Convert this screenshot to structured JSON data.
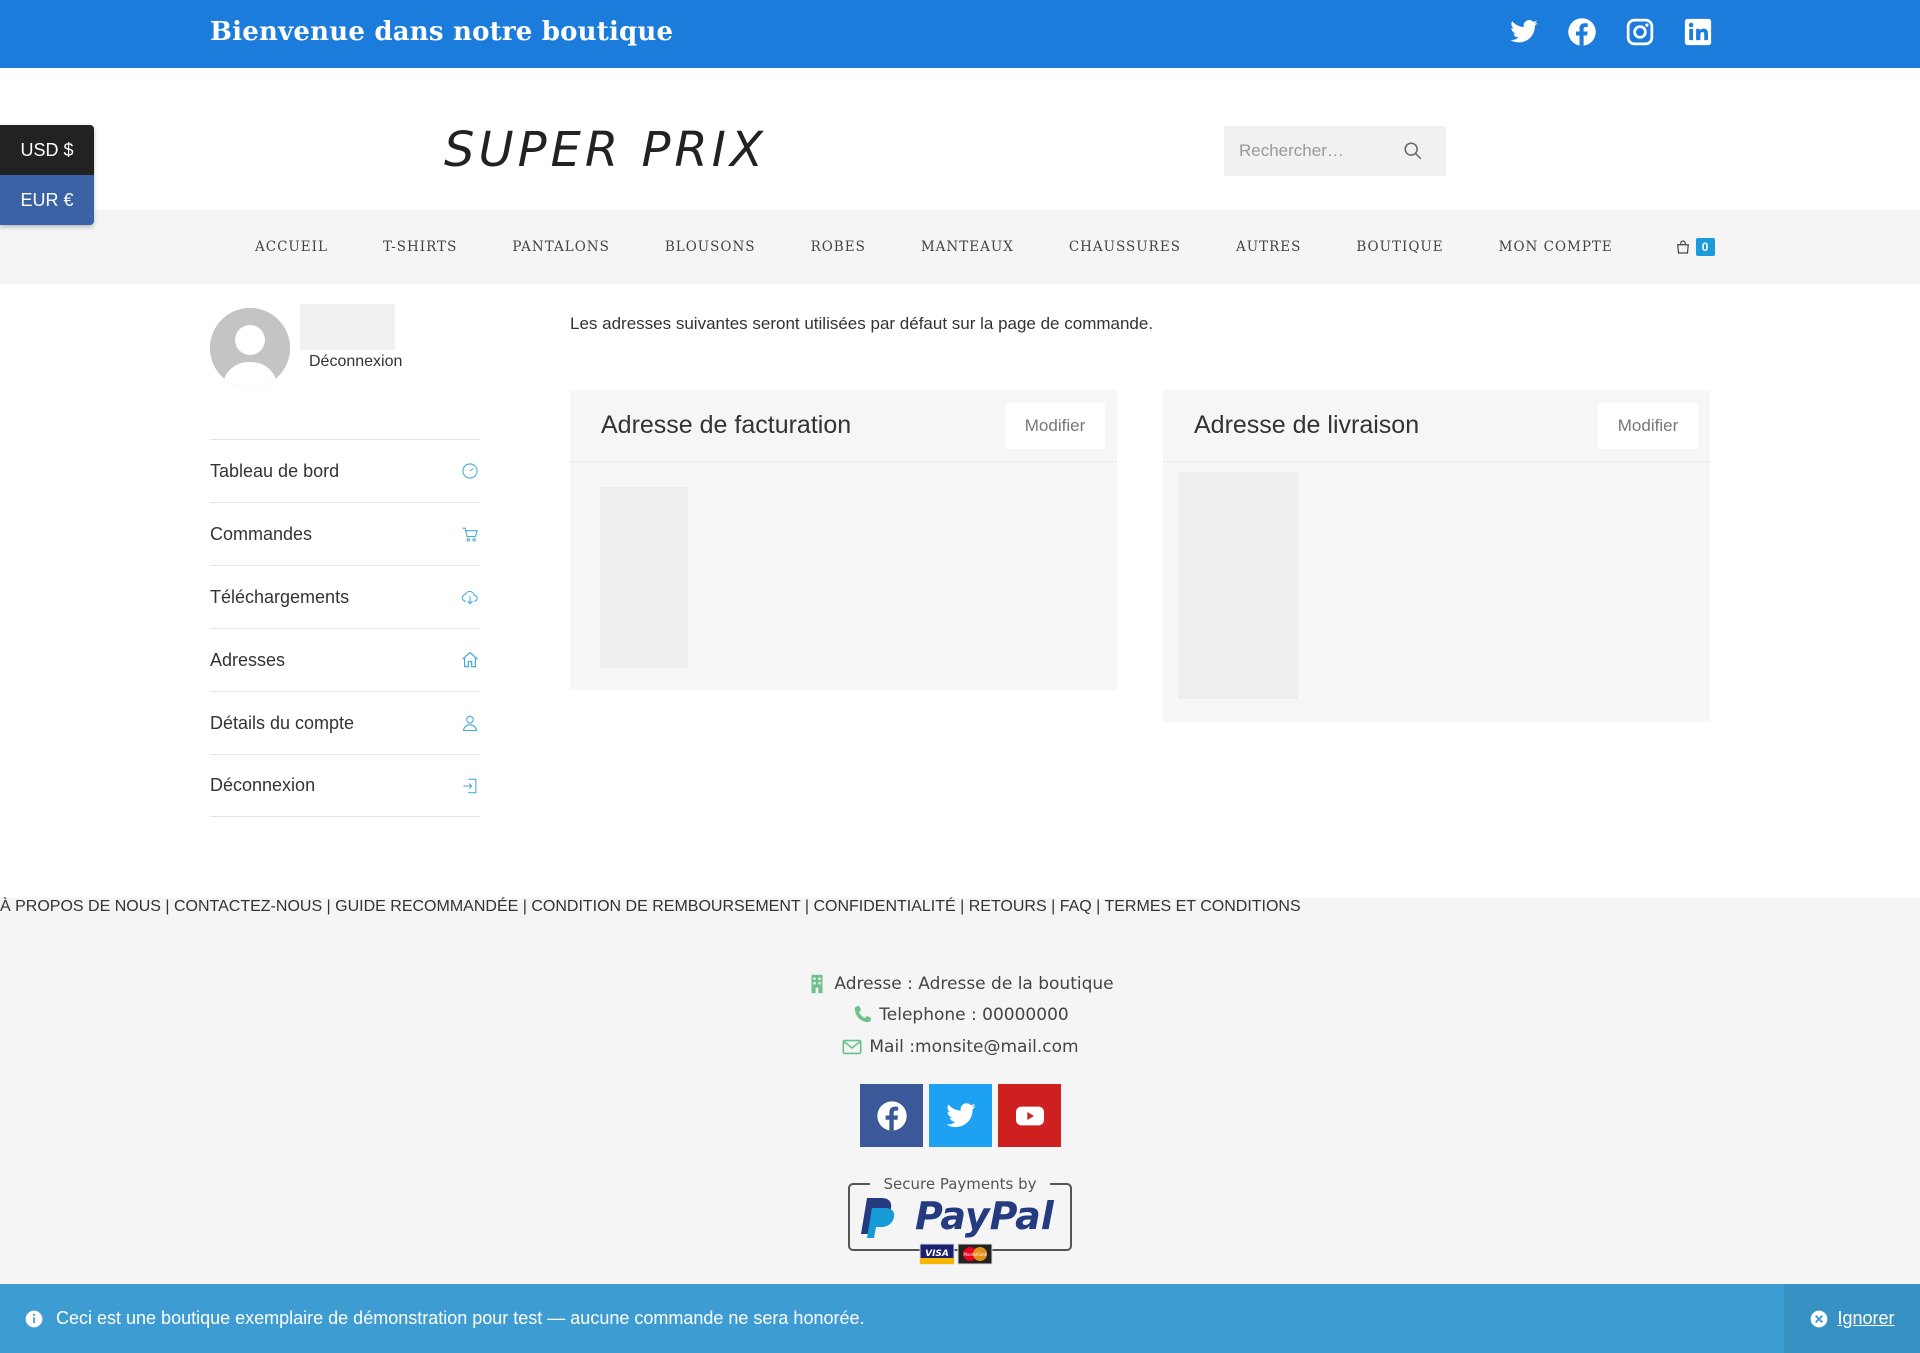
{
  "topbar": {
    "welcome": "Bienvenue dans notre boutique",
    "social_icons": [
      "twitter-icon",
      "facebook-icon",
      "instagram-icon",
      "linkedin-icon"
    ]
  },
  "currency": {
    "usd": "USD $",
    "eur": "EUR €"
  },
  "header": {
    "logo": "SUPER PRIX",
    "search_placeholder": "Rechercher…"
  },
  "nav": {
    "items": [
      "ACCUEIL",
      "T-SHIRTS",
      "PANTALONS",
      "BLOUSONS",
      "ROBES",
      "MANTEAUX",
      "CHAUSSURES",
      "AUTRES",
      "BOUTIQUE",
      "MON COMPTE"
    ],
    "cart_count": "0"
  },
  "account": {
    "logout_small": "Déconnexion",
    "menu": [
      {
        "label": "Tableau de bord",
        "icon": "dashboard-icon"
      },
      {
        "label": "Commandes",
        "icon": "cart-icon"
      },
      {
        "label": "Téléchargements",
        "icon": "cloud-download-icon"
      },
      {
        "label": "Adresses",
        "icon": "home-icon"
      },
      {
        "label": "Détails du compte",
        "icon": "user-icon"
      },
      {
        "label": "Déconnexion",
        "icon": "logout-icon"
      }
    ]
  },
  "addresses": {
    "intro": "Les adresses suivantes seront utilisées par défaut sur la page de commande.",
    "billing": {
      "title": "Adresse de facturation",
      "edit": "Modifier"
    },
    "shipping": {
      "title": "Adresse de livraison",
      "edit": "Modifier"
    }
  },
  "footer": {
    "links": [
      "À PROPOS DE NOUS",
      "CONTACTEZ-NOUS",
      "GUIDE RECOMMANDÉE",
      "CONDITION DE REMBOURSEMENT",
      "CONFIDENTIALITÉ",
      "RETOURS",
      "FAQ",
      "TERMES ET CONDITIONS"
    ],
    "address": "Adresse : Adresse de la boutique",
    "phone": "Telephone : 00000000",
    "mail": "Mail :monsite@mail.com",
    "paypal_caption": "Secure Payments by",
    "paypal_brand": "PayPal",
    "cards": [
      "VISA",
      "MasterCard"
    ],
    "colors": {
      "facebook": "#3b5998",
      "twitter": "#1da1f2",
      "youtube": "#cd201f",
      "contact_icon": "#6ec18b"
    }
  },
  "notice": {
    "text": "Ceci est une boutique exemplaire de démonstration pour test — aucune commande ne sera honorée.",
    "dismiss": "Ignorer"
  }
}
